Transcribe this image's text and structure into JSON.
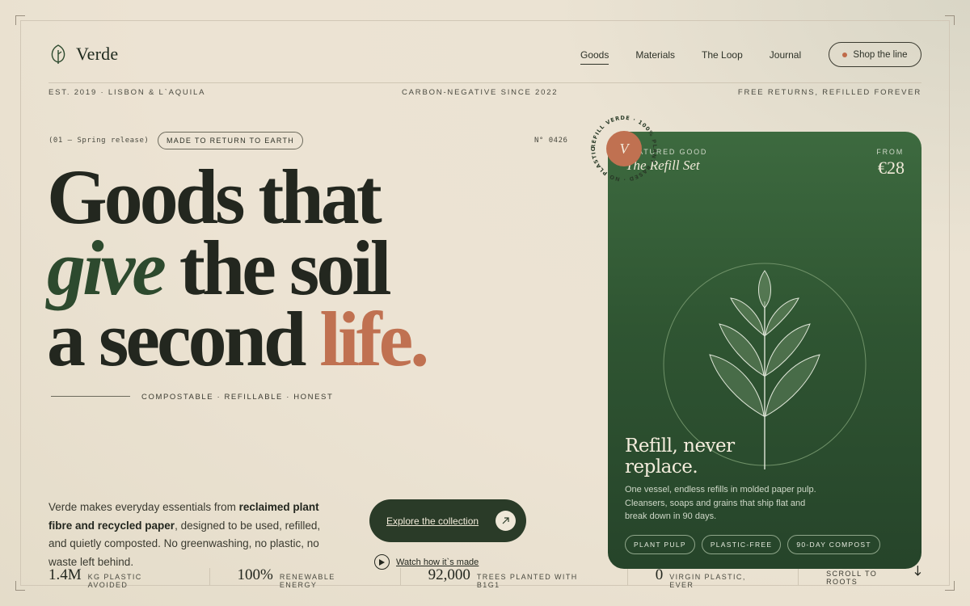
{
  "brand": {
    "name": "Verde",
    "icon": "leaf-icon"
  },
  "nav": {
    "items": [
      {
        "label": "Goods",
        "active": true
      },
      {
        "label": "Materials",
        "active": false
      },
      {
        "label": "The Loop",
        "active": false
      },
      {
        "label": "Journal",
        "active": false
      }
    ],
    "cta": "Shop the line"
  },
  "meta": {
    "left": "EST. 2019 · LISBON & L`AQUILA",
    "center": "CARBON-NEGATIVE SINCE 2022",
    "right": "FREE RETURNS, REFILLED FOREVER"
  },
  "hero": {
    "kicker": "(01 — Spring release)",
    "pill": "MADE TO RETURN TO EARTH",
    "serial": "N° 0426",
    "headline": {
      "line1": "Goods that",
      "line2_em": "give",
      "line2_rest": " the soil",
      "line3_main": "a second ",
      "line3_accent": "life."
    },
    "tagline": "COMPOSTABLE · REFILLABLE · HONEST",
    "blurb": {
      "part1": "Verde makes everyday essentials from ",
      "bold": "reclaimed plant fibre and recycled paper",
      "part2": ", designed to be used, refilled, and quietly composted. No greenwashing, no plastic, no waste left behind."
    },
    "primary_cta": "Explore the collection",
    "secondary_cta": "Watch how it`s made"
  },
  "badge": {
    "letter": "V",
    "ring_text": "REFILL VERDE · 100% PLANT BASED · NO PLASTIC ·"
  },
  "card": {
    "eyebrow": "FEATURED GOOD",
    "name": "The Refill Set",
    "from_label": "FROM",
    "price": "€28",
    "heading_line1": "Refill, never",
    "heading_line2": "replace.",
    "description": "One vessel, endless refills in molded paper pulp. Cleansers, soaps and grains that ship flat and break down in 90 days.",
    "tags": [
      "PLANT PULP",
      "PLASTIC-FREE",
      "90-DAY COMPOST"
    ],
    "illustration": "sprout-icon"
  },
  "stats": [
    {
      "num": "1.4M",
      "label": "KG PLASTIC AVOIDED"
    },
    {
      "num": "100%",
      "label": "RENEWABLE ENERGY"
    },
    {
      "num": "92,000",
      "label": "TREES PLANTED WITH B1G1"
    },
    {
      "num": "0",
      "label": "VIRGIN PLASTIC, EVER"
    }
  ],
  "scroll": "SCROLL TO ROOTS",
  "colors": {
    "forest": "#2a3b28",
    "terracotta": "#c07151",
    "paper": "#ece3d3"
  }
}
